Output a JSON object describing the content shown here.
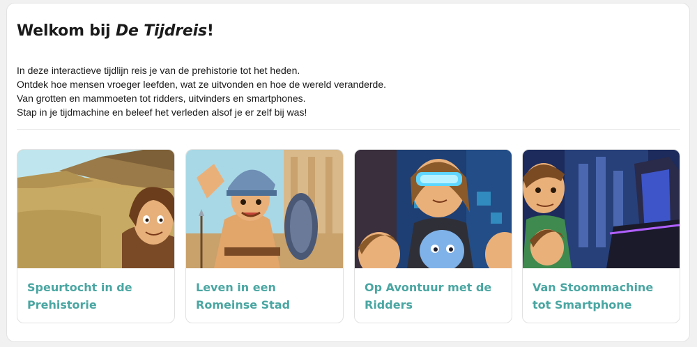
{
  "header": {
    "title_prefix": "Welkom bij ",
    "title_emphasis": "De Tijdreis",
    "title_suffix": "!"
  },
  "intro": {
    "lines": [
      "In deze interactieve tijdlijn reis je van de prehistorie tot het heden.",
      "Ontdek hoe mensen vroeger leefden, wat ze uitvonden en hoe de wereld veranderde.",
      "Van grotten en mammoeten tot ridders, uitvinders en smartphones.",
      "Stap in je tijdmachine en beleef het verleden alsof je er zelf bij was!"
    ]
  },
  "cards": [
    {
      "title": "Speurtocht in de Prehistorie",
      "image": "prehistoric-boy-illustration"
    },
    {
      "title": "Leven in een Romeinse Stad",
      "image": "roman-soldier-illustration"
    },
    {
      "title": "Op Avontuur met de Ridders",
      "image": "vr-headset-girl-illustration"
    },
    {
      "title": "Van Stoommachine tot Smartphone",
      "image": "modern-kids-illustration"
    }
  ],
  "colors": {
    "card_title": "#4aa6a2",
    "text": "#1a1a1a"
  }
}
